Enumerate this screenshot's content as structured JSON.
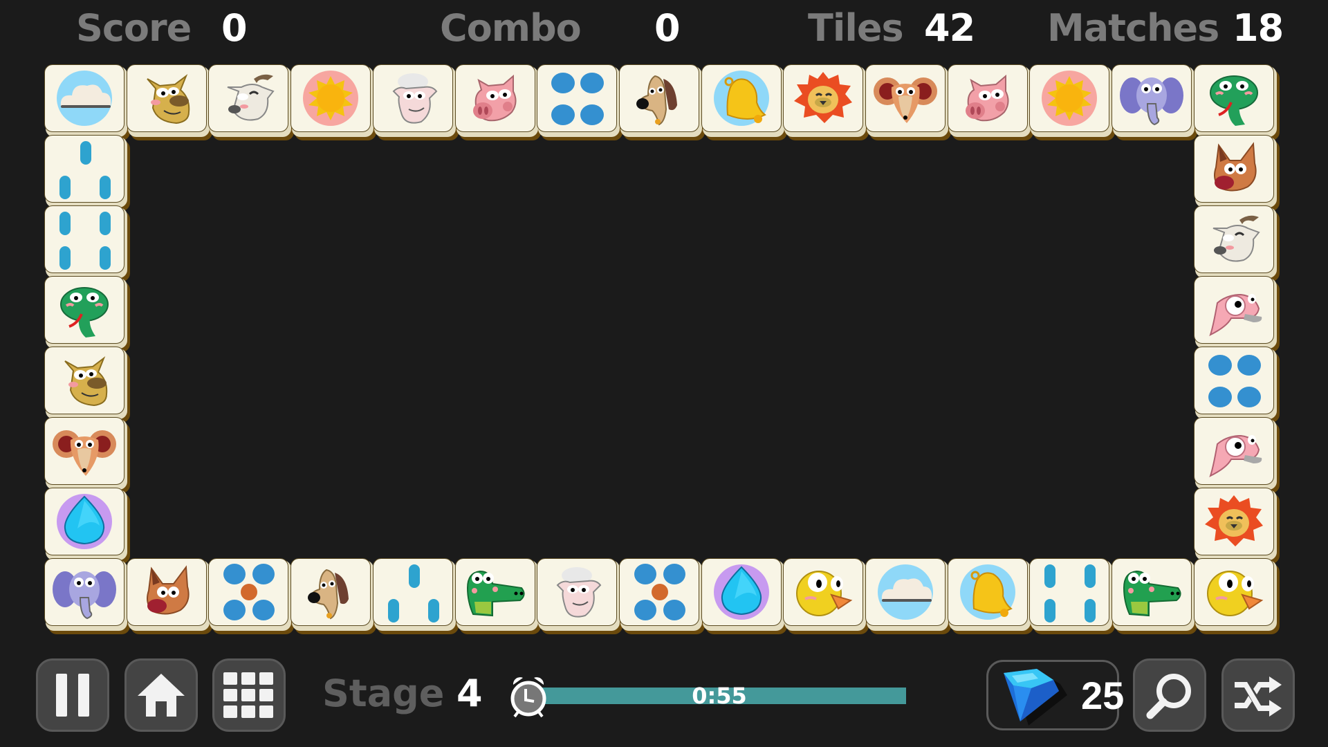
{
  "hud": {
    "score_label": "Score",
    "score": "0",
    "combo_label": "Combo",
    "combo": "0",
    "tiles_label": "Tiles",
    "tiles": "42",
    "matches_label": "Matches",
    "matches": "18"
  },
  "board": {
    "top_row": [
      "cloud",
      "camel",
      "goat",
      "sun",
      "sheep",
      "pig",
      "four-dots",
      "dog",
      "bell",
      "lion",
      "mouse",
      "pig",
      "sun",
      "elephant",
      "snake"
    ],
    "left_col": [
      "three-bars",
      "four-bars",
      "snake",
      "camel",
      "mouse",
      "water-drop"
    ],
    "right_col": [
      "fox",
      "goat",
      "flamingo",
      "four-dots",
      "flamingo",
      "lion"
    ],
    "bottom_row": [
      "elephant",
      "fox",
      "five-dots",
      "dog",
      "three-bars",
      "crocodile",
      "sheep",
      "five-dots",
      "water-drop",
      "chick",
      "cloud",
      "bell",
      "four-bars",
      "crocodile",
      "chick"
    ]
  },
  "toolbar": {
    "pause_icon": "pause-icon",
    "home_icon": "home-icon",
    "menu_icon": "grid-icon",
    "stage_label": "Stage",
    "stage": "4",
    "timer_text": "0:55",
    "timer_fraction": 0.0,
    "gems": "25",
    "hint_icon": "magnifier-icon",
    "shuffle_icon": "shuffle-icon"
  },
  "colors": {
    "background": "#1b1b1b",
    "tile_face": "#f8f5e6",
    "timer_bar": "#44999a",
    "button_bg": "#444444",
    "label_gray": "#7b7b7b"
  }
}
